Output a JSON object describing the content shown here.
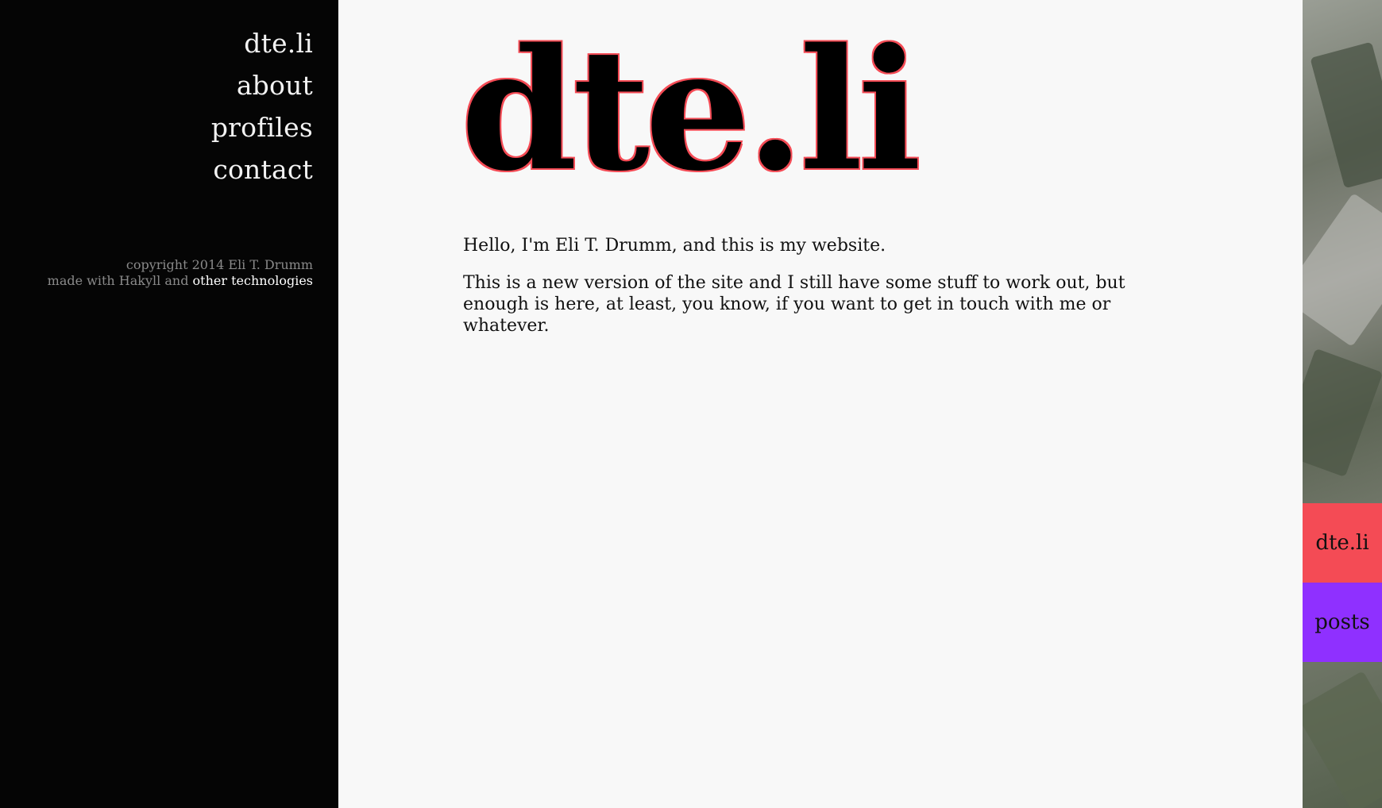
{
  "sidebar": {
    "nav": [
      {
        "label": "dte.li"
      },
      {
        "label": "about"
      },
      {
        "label": "profiles"
      },
      {
        "label": "contact"
      }
    ],
    "footer": {
      "copyright": "copyright 2014 Eli T. Drumm",
      "made_with": "made with Hakyll and",
      "link_label": "other technologies"
    }
  },
  "main": {
    "title": "dte.li",
    "paragraphs": [
      "Hello, I'm Eli T. Drumm, and this is my website.",
      "This is a new version of the site and I still have some stuff to work out, but enough is here, at least, you know, if you want to get in touch with me or whatever."
    ]
  },
  "side_tiles": [
    {
      "label": "dte.li",
      "color": "#f44b55"
    },
    {
      "label": "posts",
      "color": "#8f30ff"
    }
  ],
  "colors": {
    "sidebar_bg": "#050505",
    "page_bg": "#f8f8f8",
    "accent_red": "#f44b55",
    "accent_purple": "#8f30ff"
  }
}
